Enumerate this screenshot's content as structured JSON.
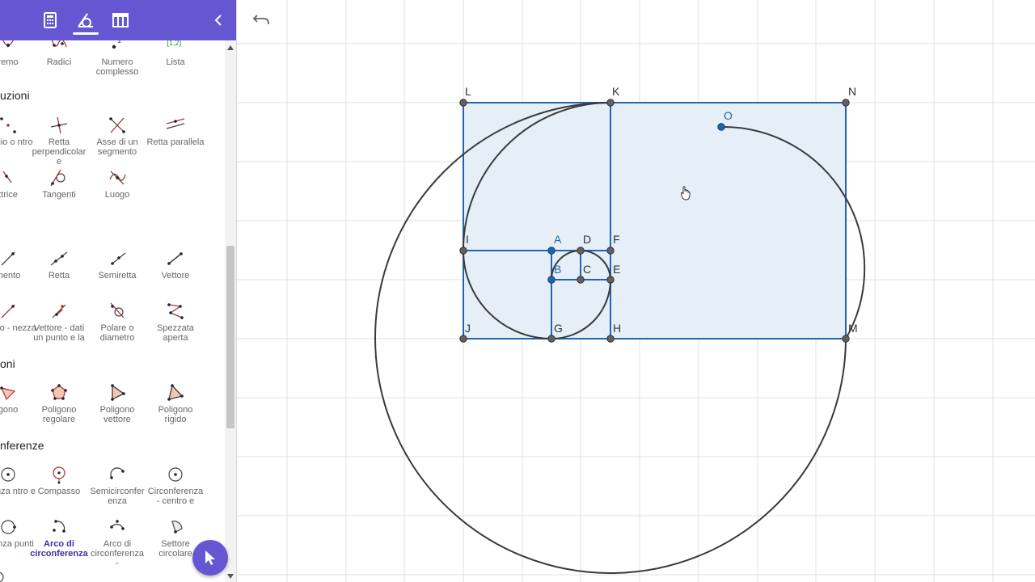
{
  "toolbar": {
    "icons": [
      "calculator-icon",
      "geometry-tools-icon",
      "table-icon",
      "chevron-left-icon"
    ],
    "active_tab": "geometry-tools-icon",
    "accent": "#6557d2"
  },
  "sections": {
    "constructions": "uzioni",
    "lines": "",
    "polygons": "oni",
    "circles": "nferenze"
  },
  "tools": {
    "extremum": "remo",
    "roots": "Radici",
    "complex_number": "Numero complesso",
    "list": "Lista",
    "list_icon_text": "{1,2}",
    "midpoint": "medio o ntro",
    "perpendicular": "Retta perpendicolare",
    "bisector": "Asse di un segmento",
    "parallel": "Retta parallela",
    "angle_bisector": "ttrice",
    "tangents": "Tangenti",
    "locus": "Luogo",
    "segment": "mento",
    "line": "Retta",
    "ray": "Semiretta",
    "vector": "Vettore",
    "segment_length": "mento - nezza",
    "vector_from_point": "Vettore - dati un punto e la",
    "polar": "Polare o diametro",
    "polyline": "Spezzata aperta",
    "polygon": "gono",
    "regular_polygon": "Poligono regolare",
    "vector_polygon": "Poligono vettore",
    "rigid_polygon": "Poligono rigido",
    "circle_center_point": "ferenza ntro e",
    "compass": "Compasso",
    "semicircle": "Semicirconferenza",
    "circle_center_radius": "Circonferenza - centro e",
    "circle_three_points": "ferenza punti",
    "arc": "Arco di circonferenza",
    "arc_3pt": "Arco di circonferenza -",
    "sector": "Settore circolare"
  },
  "points": {
    "L": "L",
    "K": "K",
    "N": "N",
    "O": "O",
    "I": "I",
    "A": "A",
    "D": "D",
    "F": "F",
    "B": "B",
    "C": "C",
    "E": "E",
    "J": "J",
    "G": "G",
    "H": "H",
    "M": "M"
  },
  "colors": {
    "rect_fill": "#e6eef8",
    "rect_stroke": "#1f65b0",
    "curve": "#3a3a3a",
    "grid": "#e0e0e0"
  },
  "canvas": {
    "undo_icon": "undo-icon",
    "cursor_icon": "hand-cursor-icon"
  }
}
